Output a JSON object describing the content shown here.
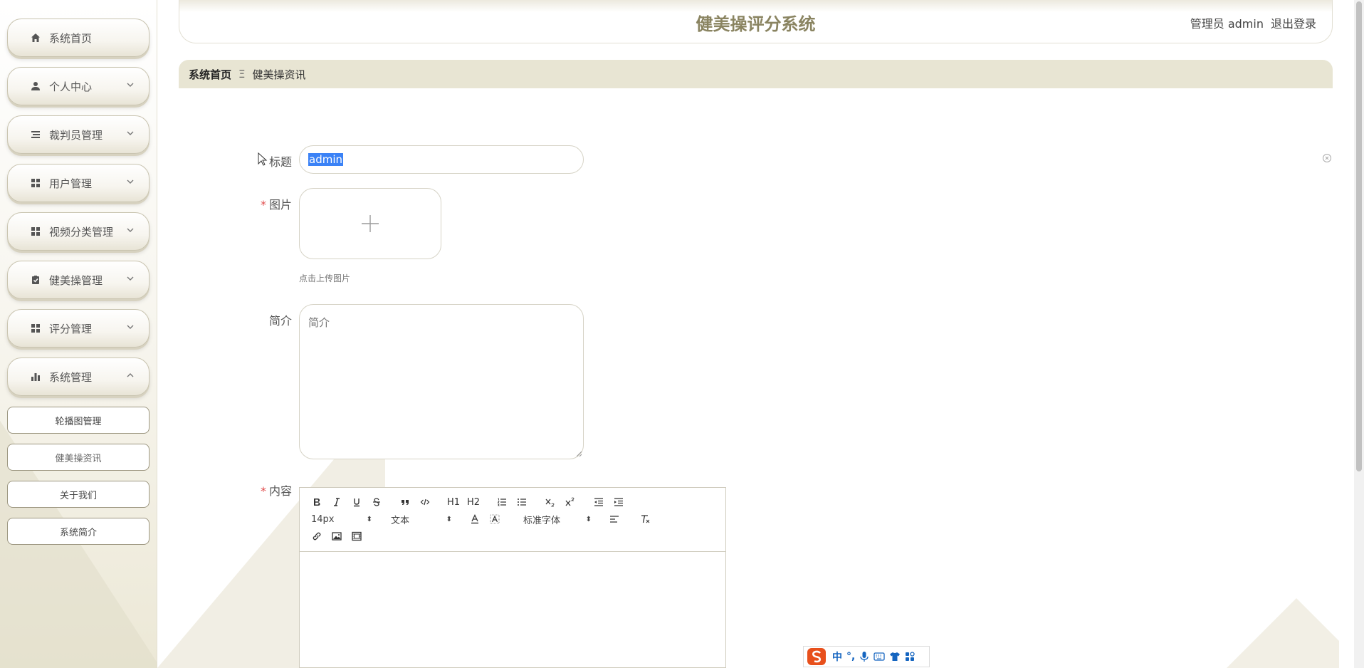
{
  "app": {
    "title": "健美操评分系统",
    "user_label": "管理员 admin",
    "logout_label": "退出登录"
  },
  "sidebar": {
    "items": [
      {
        "label": "系统首页",
        "icon": "home-icon",
        "has_chevron": false
      },
      {
        "label": "个人中心",
        "icon": "user-icon",
        "has_chevron": true
      },
      {
        "label": "裁判员管理",
        "icon": "list-icon",
        "has_chevron": true
      },
      {
        "label": "用户管理",
        "icon": "grid-icon",
        "has_chevron": true
      },
      {
        "label": "视频分类管理",
        "icon": "grid-icon",
        "has_chevron": true
      },
      {
        "label": "健美操管理",
        "icon": "clipboard-check-icon",
        "has_chevron": true
      },
      {
        "label": "评分管理",
        "icon": "grid-icon",
        "has_chevron": true
      },
      {
        "label": "系统管理",
        "icon": "bar-chart-icon",
        "has_chevron": true,
        "expanded": true
      }
    ],
    "sub_items": [
      {
        "label": "轮播图管理"
      },
      {
        "label": "健美操资讯"
      },
      {
        "label": "关于我们"
      },
      {
        "label": "系统简介"
      }
    ]
  },
  "breadcrumb": {
    "home": "系统首页",
    "separator": "Ξ",
    "current": "健美操资讯"
  },
  "form": {
    "title_label": "标题",
    "title_value": "admin",
    "image_label": "图片",
    "upload_hint": "点击上传图片",
    "intro_label": "简介",
    "intro_placeholder": "简介",
    "content_label": "内容",
    "required_mark": "*"
  },
  "editor": {
    "font_size": "14px",
    "text_style": "文本",
    "font_family": "标准字体",
    "h1": "H1",
    "h2": "H2"
  },
  "ime": {
    "mode": "中",
    "punct": "°,"
  },
  "colors": {
    "accent": "#8a8461",
    "breadcrumb_bg": "#e8e5d3",
    "required": "#e04b4b",
    "selection": "#3b82f6"
  }
}
